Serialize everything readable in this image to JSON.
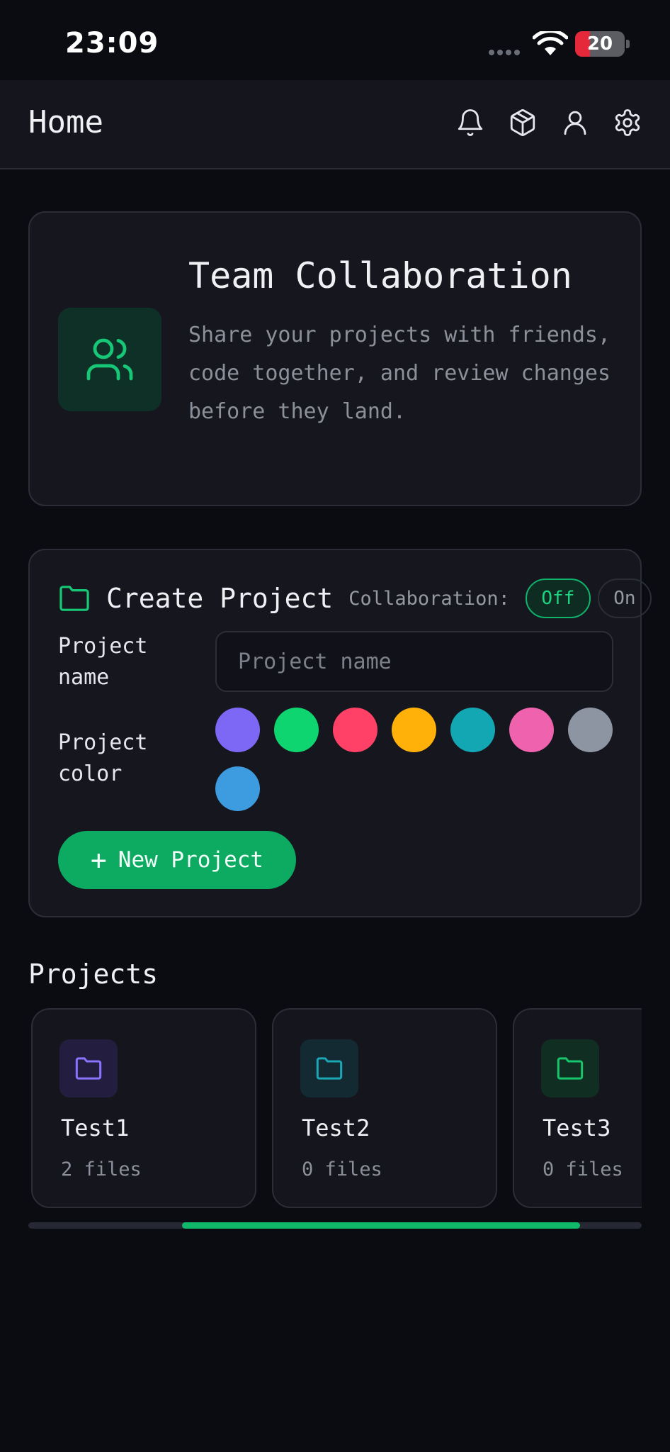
{
  "status_bar": {
    "time": "23:09",
    "battery": "20",
    "battery_level": 0.3
  },
  "header": {
    "title": "Home",
    "icons": [
      "bell-icon",
      "package-icon",
      "user-icon",
      "gear-icon"
    ]
  },
  "hero": {
    "icon": "users-icon",
    "title": "Team Collaboration",
    "description": "Share your projects with friends, code together, and review changes before they land."
  },
  "create_project": {
    "icon": "folder-icon",
    "title": "Create Project",
    "collaboration_label": "Collaboration:",
    "toggle_off": "Off",
    "toggle_on": "On",
    "selected_toggle": "Off",
    "name_label": "Project name",
    "name_placeholder": "Project name",
    "name_value": "",
    "color_label": "Project color",
    "colors": [
      "#7d67f5",
      "#0ed56f",
      "#ff4067",
      "#ffb10a",
      "#12a7b3",
      "#ef62ad",
      "#8d95a3",
      "#3d9be0"
    ],
    "button_label": "New Project",
    "button_icon": "plus-icon"
  },
  "projects": {
    "title": "Projects",
    "items": [
      {
        "name": "Test1",
        "files": "2 files",
        "color": "#8b73ff",
        "tint": "#231e3f"
      },
      {
        "name": "Test2",
        "files": "0 files",
        "color": "#1ba7b5",
        "tint": "#142a32"
      },
      {
        "name": "Test3",
        "files": "0 files",
        "color": "#16c66b",
        "tint": "#112e22"
      }
    ],
    "scroll_position": 0.25,
    "scroll_visible_fraction": 0.65
  },
  "colors": {
    "accent": "#0daa61",
    "background": "#0b0c11",
    "card": "#16171e"
  }
}
